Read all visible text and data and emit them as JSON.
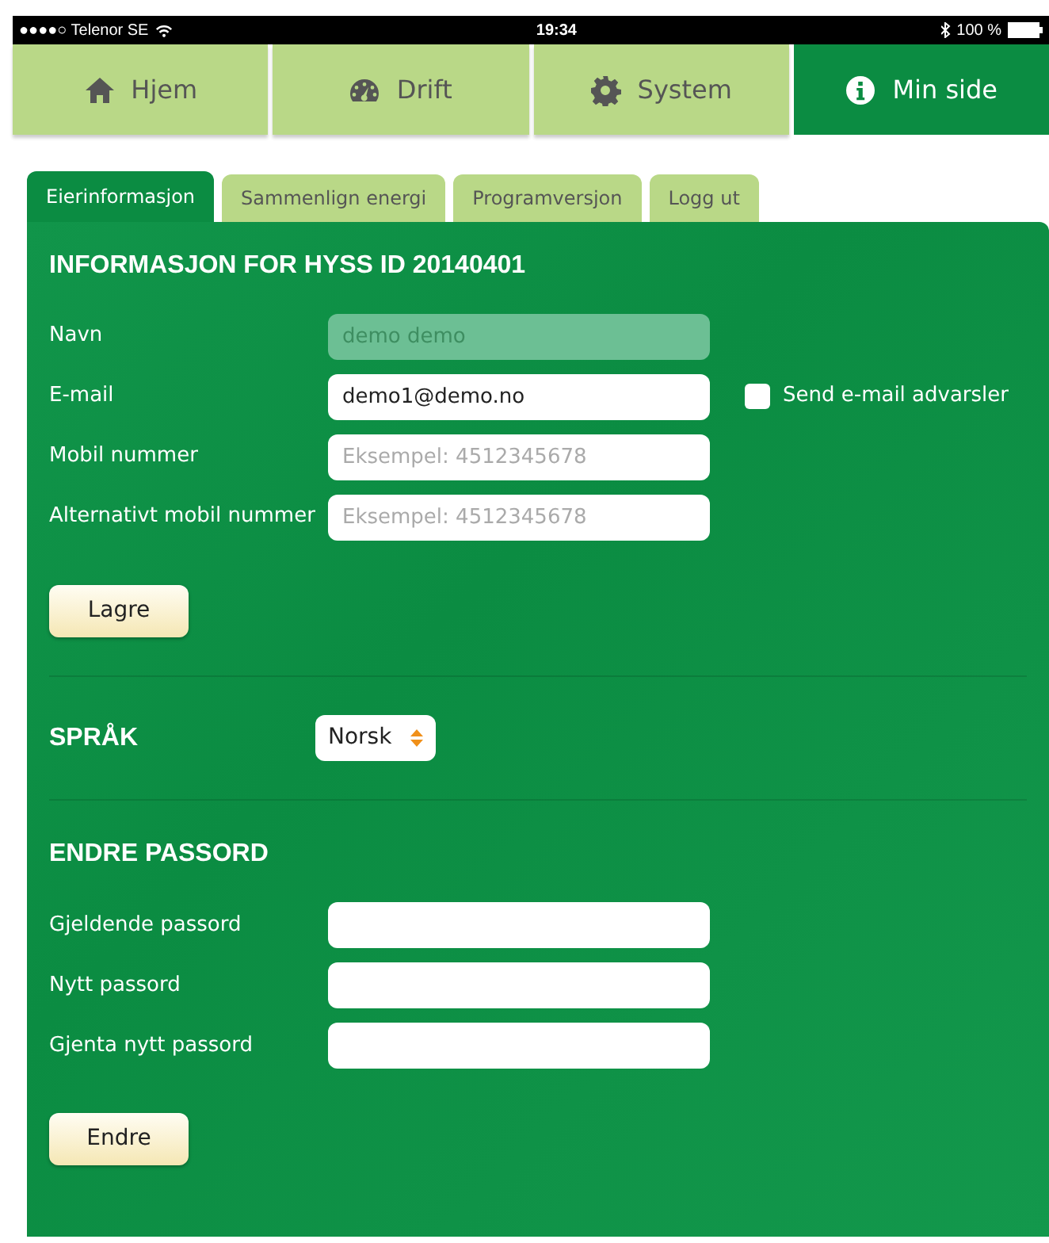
{
  "status_bar": {
    "carrier": "●●●●○ Telenor SE",
    "time": "19:34",
    "battery": "100 %"
  },
  "nav": [
    {
      "label": "Hjem",
      "kind": "home",
      "selected": false
    },
    {
      "label": "Drift",
      "kind": "gauge",
      "selected": false
    },
    {
      "label": "System",
      "kind": "gear",
      "selected": false
    },
    {
      "label": "Min side",
      "kind": "info",
      "selected": true
    }
  ],
  "tabs": [
    {
      "label": "Eierinformasjon",
      "selected": true
    },
    {
      "label": "Sammenlign energi",
      "selected": false
    },
    {
      "label": "Programversjon",
      "selected": false
    },
    {
      "label": "Logg ut",
      "selected": false
    }
  ],
  "info": {
    "title": "INFORMASJON FOR HYSS ID 20140401",
    "fields": [
      {
        "label": "Navn",
        "value": "demo demo",
        "disabled": true
      },
      {
        "label": "E-mail",
        "value": "demo1@demo.no",
        "disabled": false
      },
      {
        "label": "Mobil nummer",
        "placeholder": "Eksempel: 4512345678",
        "disabled": false
      },
      {
        "label": "Alternativt mobil nummer",
        "placeholder": "Eksempel: 4512345678",
        "disabled": false
      }
    ],
    "checkbox": {
      "label": "Send e-mail advarsler",
      "checked": false
    },
    "button": "Lagre"
  },
  "language": {
    "title": "SPRÅK",
    "value": "Norsk"
  },
  "password": {
    "title": "ENDRE PASSORD",
    "fields": [
      {
        "label": "Gjeldende passord"
      },
      {
        "label": "Nytt passord"
      },
      {
        "label": "Gjenta nytt passord"
      }
    ],
    "button": "Endre"
  }
}
